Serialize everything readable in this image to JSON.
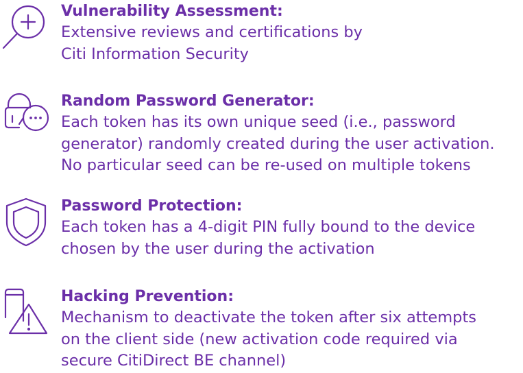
{
  "theme": {
    "accent": "#6b2fa8"
  },
  "features": [
    {
      "icon": "magnifier-plus-icon",
      "title": "Vulnerability Assessment:",
      "lines": [
        "Extensive reviews and certifications by",
        "Citi Information Security"
      ]
    },
    {
      "icon": "lock-chat-icon",
      "title": "Random Password Generator:",
      "lines": [
        "Each token has its own unique seed (i.e., password",
        "generator) randomly created during the user activation.",
        "No particular seed can be re-used on multiple tokens"
      ]
    },
    {
      "icon": "shield-icon",
      "title": "Password Protection:",
      "lines": [
        "Each token has a 4-digit PIN fully bound to the device",
        "chosen by the user during the activation"
      ]
    },
    {
      "icon": "phone-warning-icon",
      "title": "Hacking Prevention:",
      "lines": [
        "Mechanism to deactivate the token after six attempts",
        "on the client side (new activation code required via",
        "secure CitiDirect BE channel)"
      ]
    }
  ]
}
